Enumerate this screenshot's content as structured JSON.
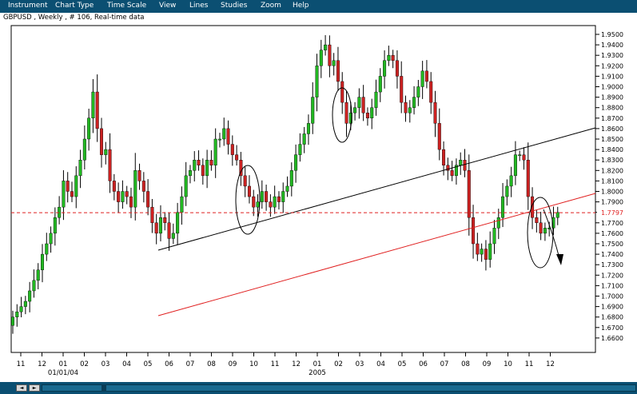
{
  "menu": [
    "Instrument",
    "Chart Type",
    "Time Scale",
    "View",
    "Lines",
    "Studies",
    "Zoom",
    "Help"
  ],
  "title": "GBPUSD , Weekly , # 106, Real-time data",
  "colors": {
    "menubar": "#0b4f72",
    "up": "#22b822",
    "down": "#cc2222",
    "trend": "#000000",
    "channel": "#e02020",
    "hline": "#e02020"
  },
  "chart_data": {
    "type": "candlestick",
    "symbol": "GBPUSD",
    "timeframe": "Weekly",
    "y_ticks": [
      "1.9500",
      "1.9400",
      "1.9300",
      "1.9200",
      "1.9100",
      "1.9000",
      "1.8900",
      "1.8800",
      "1.8700",
      "1.8600",
      "1.8500",
      "1.8400",
      "1.8300",
      "1.8200",
      "1.8100",
      "1.8000",
      "1.7900",
      "1.7800",
      "1.7700",
      "1.7600",
      "1.7500",
      "1.7400",
      "1.7300",
      "1.7200",
      "1.7100",
      "1.7000",
      "1.6900",
      "1.6800",
      "1.6700",
      "1.6600"
    ],
    "ylim": [
      1.66,
      1.95
    ],
    "x_ticks": [
      "11",
      "12",
      "01",
      "02",
      "03",
      "04",
      "05",
      "06",
      "07",
      "08",
      "09",
      "10",
      "11",
      "12",
      "01",
      "02",
      "03",
      "04",
      "05",
      "06",
      "07",
      "08",
      "09",
      "10",
      "11",
      "12"
    ],
    "x_sublabels": [
      {
        "after_tick": 2,
        "text": "01/01/04"
      },
      {
        "after_tick": 14,
        "text": "2005"
      }
    ],
    "current_price": {
      "value": 1.7797,
      "label": "1.7797"
    },
    "closes": [
      1.68,
      1.685,
      1.69,
      1.695,
      1.705,
      1.715,
      1.725,
      1.74,
      1.75,
      1.76,
      1.775,
      1.785,
      1.81,
      1.8,
      1.795,
      1.815,
      1.83,
      1.85,
      1.87,
      1.895,
      1.86,
      1.835,
      1.84,
      1.81,
      1.8,
      1.79,
      1.8,
      1.795,
      1.785,
      1.82,
      1.81,
      1.8,
      1.785,
      1.77,
      1.76,
      1.775,
      1.77,
      1.755,
      1.76,
      1.78,
      1.795,
      1.815,
      1.82,
      1.83,
      1.825,
      1.815,
      1.83,
      1.825,
      1.85,
      1.85,
      1.86,
      1.845,
      1.835,
      1.83,
      1.815,
      1.805,
      1.795,
      1.785,
      1.79,
      1.8,
      1.79,
      1.785,
      1.795,
      1.79,
      1.8,
      1.805,
      1.82,
      1.835,
      1.845,
      1.855,
      1.865,
      1.89,
      1.92,
      1.935,
      1.94,
      1.92,
      1.925,
      1.905,
      1.885,
      1.865,
      1.875,
      1.88,
      1.89,
      1.875,
      1.87,
      1.88,
      1.895,
      1.91,
      1.925,
      1.93,
      1.925,
      1.91,
      1.885,
      1.875,
      1.88,
      1.89,
      1.9,
      1.915,
      1.905,
      1.885,
      1.865,
      1.84,
      1.825,
      1.82,
      1.815,
      1.825,
      1.83,
      1.82,
      1.775,
      1.75,
      1.74,
      1.745,
      1.735,
      1.75,
      1.765,
      1.775,
      1.795,
      1.805,
      1.815,
      1.835,
      1.835,
      1.83,
      1.795,
      1.775,
      1.77,
      1.76,
      1.765,
      1.765,
      1.775,
      1.78
    ]
  }
}
